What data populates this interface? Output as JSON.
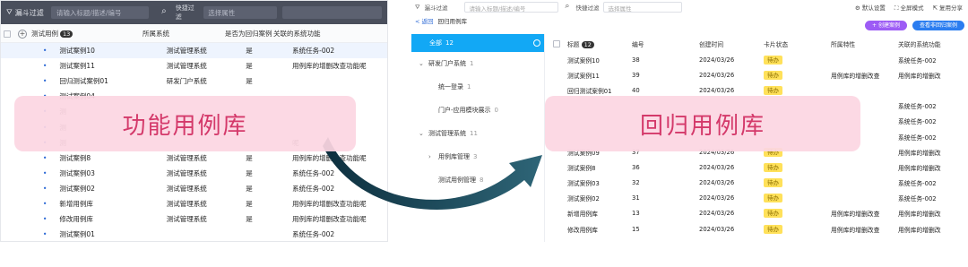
{
  "left": {
    "topbar": {
      "title": "漏斗过滤",
      "search_placeholder": "请输入标题/描述/编号",
      "quick_filter": "快捷过滤",
      "attr_placeholder": "选择属性"
    },
    "header": {
      "name": "测试用例",
      "count": "13",
      "system": "所属系统",
      "regression": "是否为回归案例",
      "function": "关联的系统功能"
    },
    "rows": [
      {
        "name": "测试案例10",
        "system": "测试管理系统",
        "regression": "是",
        "function": "系统任务-002"
      },
      {
        "name": "测试案例11",
        "system": "测试管理系统",
        "regression": "是",
        "function": "用例库的增删改查功能呢"
      },
      {
        "name": "回归测试案例01",
        "system": "研发门户系统",
        "regression": "是",
        "function": ""
      },
      {
        "name": "测试案例04",
        "system": "",
        "regression": "",
        "function": ""
      },
      {
        "name": "测",
        "system": "",
        "regression": "",
        "function": ""
      },
      {
        "name": "测",
        "system": "",
        "regression": "",
        "function": ""
      },
      {
        "name": "测",
        "system": "",
        "regression": "",
        "function": "呢"
      },
      {
        "name": "测试案例8",
        "system": "测试管理系统",
        "regression": "是",
        "function": "用例库的增删改查功能呢"
      },
      {
        "name": "测试案例03",
        "system": "测试管理系统",
        "regression": "是",
        "function": "系统任务-002"
      },
      {
        "name": "测试案例02",
        "system": "测试管理系统",
        "regression": "是",
        "function": "系统任务-002"
      },
      {
        "name": "新增用例库",
        "system": "测试管理系统",
        "regression": "是",
        "function": "用例库的增删改查功能呢"
      },
      {
        "name": "修改用例库",
        "system": "测试管理系统",
        "regression": "是",
        "function": "用例库的增删改查功能呢"
      },
      {
        "name": "测试案例01",
        "system": "",
        "regression": "",
        "function": "系统任务-002"
      }
    ]
  },
  "right": {
    "topbar": {
      "title": "漏斗过滤",
      "search_placeholder": "请输入标题/描述/编号",
      "quick_filter": "快捷过滤",
      "attr_placeholder": "选择属性",
      "tool_default": "默认设置",
      "tool_fullscreen": "全屏模式",
      "tool_share": "复用分享"
    },
    "subbar": {
      "back": "< 返回",
      "name": "回归用例库"
    },
    "buttons": {
      "create": "+ 创建案例",
      "view_non_regression": "查看非回归案例"
    },
    "tree": [
      {
        "label": "全部",
        "count": "12",
        "selected": true,
        "indent": 0,
        "arrow": ""
      },
      {
        "label": "研发门户系统",
        "count": "1",
        "indent": 0,
        "arrow": "⌄"
      },
      {
        "label": "统一登录",
        "count": "1",
        "indent": 2,
        "arrow": ""
      },
      {
        "label": "门户-应用模块展示",
        "count": "0",
        "indent": 2,
        "arrow": ""
      },
      {
        "label": "测试管理系统",
        "count": "11",
        "indent": 0,
        "arrow": "⌄"
      },
      {
        "label": "用例库管理",
        "count": "3",
        "indent": 1,
        "arrow": "›"
      },
      {
        "label": "测试用例管理",
        "count": "8",
        "indent": 2,
        "arrow": ""
      }
    ],
    "header": {
      "title": "标题",
      "count": "12",
      "number": "编号",
      "created": "创建时间",
      "state": "卡片状态",
      "attr": "所属特性",
      "function": "关联的系统功能"
    },
    "rows": [
      {
        "name": "测试案例10",
        "no": "38",
        "time": "2024/03/26",
        "state": "待办",
        "attr": "",
        "function": "系统任务-002"
      },
      {
        "name": "测试案例11",
        "no": "39",
        "time": "2024/03/26",
        "state": "待办",
        "attr": "用例库的增删改查",
        "function": "用例库的增删改"
      },
      {
        "name": "回归测试案例01",
        "no": "40",
        "time": "2024/03/26",
        "state": "待办",
        "attr": "",
        "function": ""
      },
      {
        "name": "",
        "no": "",
        "time": "",
        "state": "",
        "attr": "",
        "function": "系统任务-002"
      },
      {
        "name": "",
        "no": "",
        "time": "",
        "state": "",
        "attr": "",
        "function": "系统任务-002"
      },
      {
        "name": "",
        "no": "",
        "time": "",
        "state": "",
        "attr": "",
        "function": "系统任务-002"
      },
      {
        "name": "测试案例09",
        "no": "37",
        "time": "2024/03/26",
        "state": "待办",
        "attr": "",
        "function": "用例库的增删改"
      },
      {
        "name": "测试案例8",
        "no": "36",
        "time": "2024/03/26",
        "state": "待办",
        "attr": "",
        "function": "用例库的增删改"
      },
      {
        "name": "测试案例03",
        "no": "32",
        "time": "2024/03/26",
        "state": "待办",
        "attr": "",
        "function": "系统任务-002"
      },
      {
        "name": "测试案例02",
        "no": "31",
        "time": "2024/03/26",
        "state": "待办",
        "attr": "",
        "function": "系统任务-002"
      },
      {
        "name": "新增用例库",
        "no": "13",
        "time": "2024/03/26",
        "state": "待办",
        "attr": "用例库的增删改查",
        "function": "用例库的增删改"
      },
      {
        "name": "修改用例库",
        "no": "15",
        "time": "2024/03/26",
        "state": "待办",
        "attr": "用例库的增删改查",
        "function": "用例库的增删改"
      }
    ]
  },
  "overlay": {
    "left_label": "功能用例库",
    "right_label": "回归用例库"
  },
  "colors": {
    "banner_text": "#d4396a",
    "banner_bg": "#fcd6e2",
    "arrow": "#1f4a5c",
    "selected_tree": "#12a8f5",
    "pending_pill": "#ffe15a"
  }
}
